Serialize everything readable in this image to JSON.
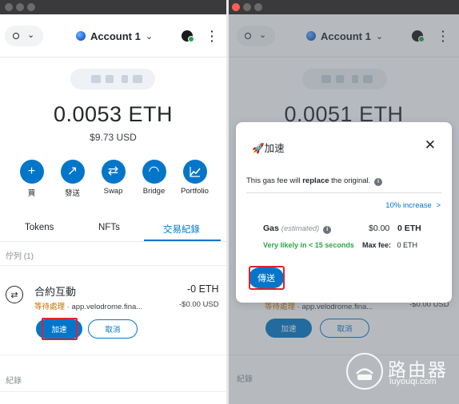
{
  "network": {
    "selector_symbol": "o",
    "chevron": "⌄"
  },
  "account": {
    "name": "Account 1",
    "chevron": "⌄"
  },
  "left": {
    "balance": "0.0053 ETH",
    "balance_usd": "$9.73 USD",
    "actions": [
      {
        "label": "買",
        "icon": "plus-icon",
        "glyph": "+"
      },
      {
        "label": "發送",
        "icon": "arrow-up-right-icon",
        "glyph": "↗"
      },
      {
        "label": "Swap",
        "icon": "swap-icon",
        "glyph": "⇄"
      },
      {
        "label": "Bridge",
        "icon": "bridge-icon",
        "glyph": "◠"
      },
      {
        "label": "Portfolio",
        "icon": "chart-icon",
        "glyph": "📈"
      }
    ],
    "tabs": {
      "tokens": "Tokens",
      "nfts": "NFTs",
      "activity": "交易紀錄"
    },
    "queue_label": "佇列 (1)",
    "tx": {
      "title": "合約互動",
      "amount": "-0 ETH",
      "status": "等待處理",
      "origin": " · app.velodrome.fina...",
      "usd": "-$0.00 USD",
      "speed_up_label": "加速",
      "cancel_label": "取消"
    },
    "history_label": "紀錄"
  },
  "right": {
    "balance": "0.0051 ETH",
    "tx": {
      "status": "等待處理",
      "origin": " · app.velodrome.fina...",
      "usd": "-$0.00 USD",
      "speed_up_label": "加速",
      "cancel_label": "取消"
    },
    "history_label": "紀錄",
    "modal": {
      "title": "🚀加速",
      "desc_before": "This gas fee will ",
      "desc_bold": "replace",
      "desc_after": " the original.",
      "increase_label": "10% increase",
      "increase_chevron": ">",
      "gas_label": "Gas",
      "gas_estimated": "(estimated)",
      "gas_usd": "$0.00",
      "gas_eth": "0 ETH",
      "likely_label": "Very likely in < 15 seconds",
      "max_fee_label": "Max fee:",
      "max_fee_value": "0 ETH",
      "submit_label": "傳送"
    }
  },
  "watermark": {
    "text": "路由器",
    "url": "luyouqi.com"
  },
  "colors": {
    "primary": "#0376c9",
    "pending": "#c36f00",
    "success": "#28a745",
    "highlight": "#e3202a"
  }
}
